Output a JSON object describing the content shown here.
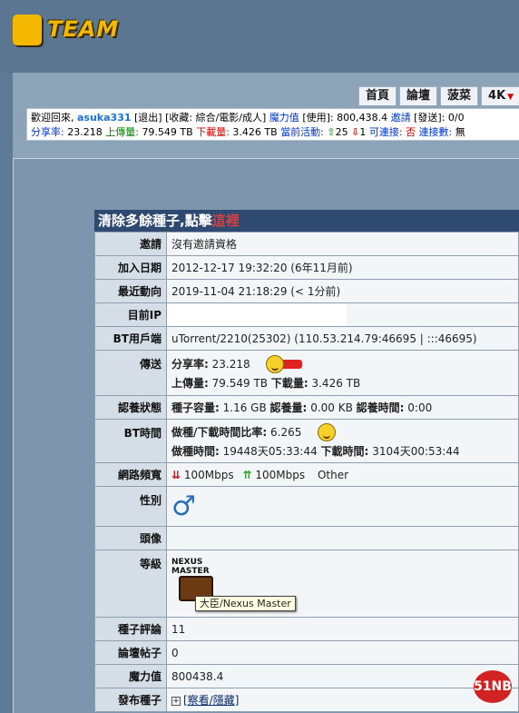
{
  "logo": {
    "text": "TEAM"
  },
  "tabs": [
    {
      "label": "首頁"
    },
    {
      "label": "論壇"
    },
    {
      "label": "菠菜"
    },
    {
      "label": "4K"
    }
  ],
  "infobar": {
    "welcome": "歡迎回來,",
    "username": "asuka331",
    "logout": "[退出]",
    "favorites": "[收藏: 綜合/電影/成人]",
    "bonus_label": "魔力值",
    "used": "[使用]: 800,438.4",
    "invite_label": "邀請",
    "sent": "[發送]: 0/0",
    "ratio_label": "分享率:",
    "ratio": "23.218",
    "upload_label": "上傳量:",
    "upload": "79.549 TB",
    "download_label": "下載量:",
    "download": "3.426 TB",
    "active_label": "當前活動:",
    "active_up": "25",
    "active_down": "1",
    "connectable_label": "可連接:",
    "connectable": "否",
    "connections_label": "連接數:",
    "connections": "無"
  },
  "profile": {
    "title_prefix": "清除多餘種子,點擊",
    "title_link": "這裡",
    "rows": {
      "invite": {
        "k": "邀請",
        "v": "沒有邀請資格"
      },
      "joined": {
        "k": "加入日期",
        "v": "2012-12-17 19:32:20 (6年11月前)"
      },
      "last": {
        "k": "最近動向",
        "v": "2019-11-04 21:18:29 (< 1分前)"
      },
      "ip": {
        "k": "目前IP"
      },
      "client": {
        "k": "BT用戶端",
        "v": "uTorrent/2210(25302) (110.53.214.79:46695 | :::46695)"
      },
      "transfer": {
        "k": "傳送",
        "ratio_l": "分享率:",
        "ratio": "23.218",
        "up_l": "上傳量:",
        "up": "79.549 TB",
        "down_l": "下載量:",
        "down": "3.426 TB"
      },
      "seed": {
        "k": "認養狀態",
        "size_l": "種子容量:",
        "size": "1.16 GB",
        "amount_l": "認養量:",
        "amount": "0.00 KB",
        "time_l": "認養時間:",
        "time": "0:00"
      },
      "bttime": {
        "k": "BT時間",
        "ratio_l": "做種/下載時間比率:",
        "ratio": "6.265",
        "seed_l": "做種時間:",
        "seed": "19448天05:33:44",
        "dl_l": "下載時間:",
        "dl": "3104天00:53:44"
      },
      "bandwidth": {
        "k": "網路頻寬",
        "down": "100Mbps",
        "up": "100Mbps",
        "other": "Other"
      },
      "gender": {
        "k": "性別",
        "symbol": "♂"
      },
      "avatar": {
        "k": "頭像"
      },
      "level": {
        "k": "等級",
        "badge_line1": "NEXUS",
        "badge_line2": "MASTER",
        "tooltip": "大臣/Nexus Master"
      },
      "comments": {
        "k": "種子評論",
        "v": "11"
      },
      "posts": {
        "k": "論壇帖子",
        "v": "0"
      },
      "bonus": {
        "k": "魔力值",
        "v": "800438.4"
      },
      "uploaded": {
        "k": "發布種子",
        "v": "[察看/隱藏]"
      }
    }
  },
  "watermark": "51NB"
}
